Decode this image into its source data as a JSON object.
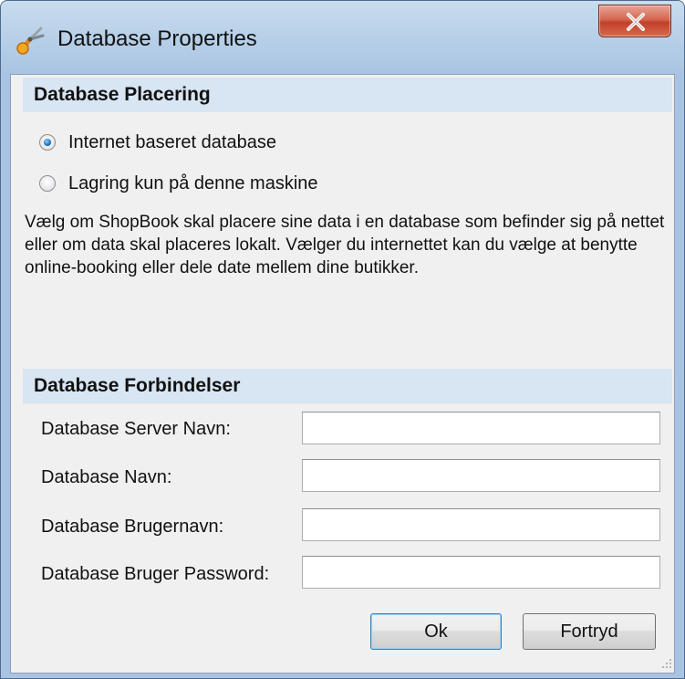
{
  "window": {
    "title": "Database Properties"
  },
  "placement": {
    "header": "Database Placering",
    "options": [
      {
        "label": "Internet baseret database",
        "checked": true
      },
      {
        "label": "Lagring kun på denne maskine",
        "checked": false
      }
    ],
    "description": "Vælg om ShopBook skal placere sine data i en database som befinder sig på nettet eller om data skal placeres lokalt. Vælger du internettet kan du vælge at benytte online-booking eller dele date mellem dine butikker."
  },
  "connections": {
    "header": "Database Forbindelser",
    "fields": [
      {
        "label": "Database Server Navn:",
        "value": ""
      },
      {
        "label": "Database Navn:",
        "value": ""
      },
      {
        "label": "Database Brugernavn:",
        "value": ""
      },
      {
        "label": "Database Bruger Password:",
        "value": ""
      }
    ]
  },
  "buttons": {
    "ok": "Ok",
    "cancel": "Fortryd"
  },
  "colors": {
    "header_bg": "#d8e5f2",
    "client_bg": "#f0f0f0",
    "close_red": "#c0402a",
    "radio_selected": "#1f6fb8"
  }
}
